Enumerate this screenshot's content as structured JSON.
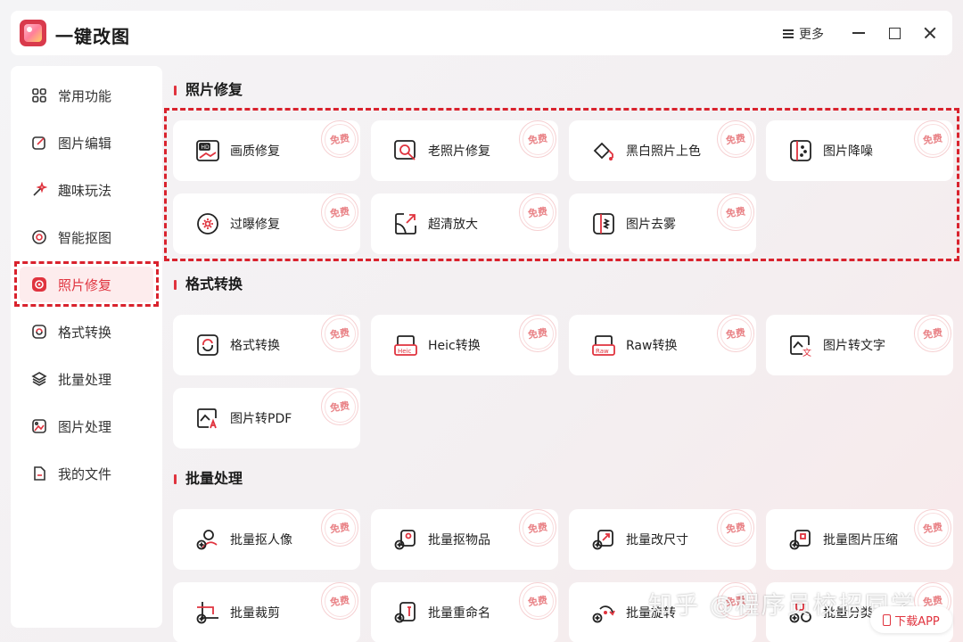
{
  "app": {
    "title": "一键改图",
    "more_label": "更多"
  },
  "sidebar": {
    "items": [
      {
        "label": "常用功能",
        "icon": "grid-icon"
      },
      {
        "label": "图片编辑",
        "icon": "edit-icon"
      },
      {
        "label": "趣味玩法",
        "icon": "sparkle-icon"
      },
      {
        "label": "智能抠图",
        "icon": "target-icon"
      },
      {
        "label": "照片修复",
        "icon": "repair-icon",
        "active": true
      },
      {
        "label": "格式转换",
        "icon": "convert-icon"
      },
      {
        "label": "批量处理",
        "icon": "layers-icon"
      },
      {
        "label": "图片处理",
        "icon": "image-icon"
      },
      {
        "label": "我的文件",
        "icon": "file-icon"
      }
    ]
  },
  "sections": [
    {
      "title": "照片修复",
      "cards": [
        {
          "label": "画质修复",
          "icon": "hd-icon",
          "badge": "免费"
        },
        {
          "label": "老照片修复",
          "icon": "old-photo-icon",
          "badge": "免费"
        },
        {
          "label": "黑白照片上色",
          "icon": "colorize-icon",
          "badge": "免费"
        },
        {
          "label": "图片降噪",
          "icon": "denoise-icon",
          "badge": "免费"
        },
        {
          "label": "过曝修复",
          "icon": "overexposure-icon",
          "badge": "免费"
        },
        {
          "label": "超清放大",
          "icon": "upscale-icon",
          "badge": "免费"
        },
        {
          "label": "图片去雾",
          "icon": "dehaze-icon",
          "badge": "免费"
        }
      ]
    },
    {
      "title": "格式转换",
      "cards": [
        {
          "label": "格式转换",
          "icon": "format-convert-icon",
          "badge": "免费"
        },
        {
          "label": "Heic转换",
          "icon": "heic-icon",
          "badge": "免费"
        },
        {
          "label": "Raw转换",
          "icon": "raw-icon",
          "badge": "免费"
        },
        {
          "label": "图片转文字",
          "icon": "ocr-icon",
          "badge": "免费"
        },
        {
          "label": "图片转PDF",
          "icon": "pdf-icon",
          "badge": "免费"
        }
      ]
    },
    {
      "title": "批量处理",
      "cards": [
        {
          "label": "批量抠人像",
          "icon": "batch-portrait-icon",
          "badge": "免费"
        },
        {
          "label": "批量抠物品",
          "icon": "batch-object-icon",
          "badge": "免费"
        },
        {
          "label": "批量改尺寸",
          "icon": "batch-resize-icon",
          "badge": "免费"
        },
        {
          "label": "批量图片压缩",
          "icon": "batch-compress-icon",
          "badge": "免费"
        },
        {
          "label": "批量裁剪",
          "icon": "batch-crop-icon",
          "badge": "免费"
        },
        {
          "label": "批量重命名",
          "icon": "batch-rename-icon",
          "badge": "免费"
        },
        {
          "label": "批量旋转",
          "icon": "batch-rotate-icon",
          "badge": "免费"
        },
        {
          "label": "批量分类",
          "icon": "batch-classify-icon",
          "badge": "免费"
        }
      ]
    }
  ],
  "download": {
    "label": "下载APP"
  },
  "watermark": "知乎 @程序员校招同学",
  "colors": {
    "accent": "#e0333e",
    "highlight": "#d9222d"
  }
}
